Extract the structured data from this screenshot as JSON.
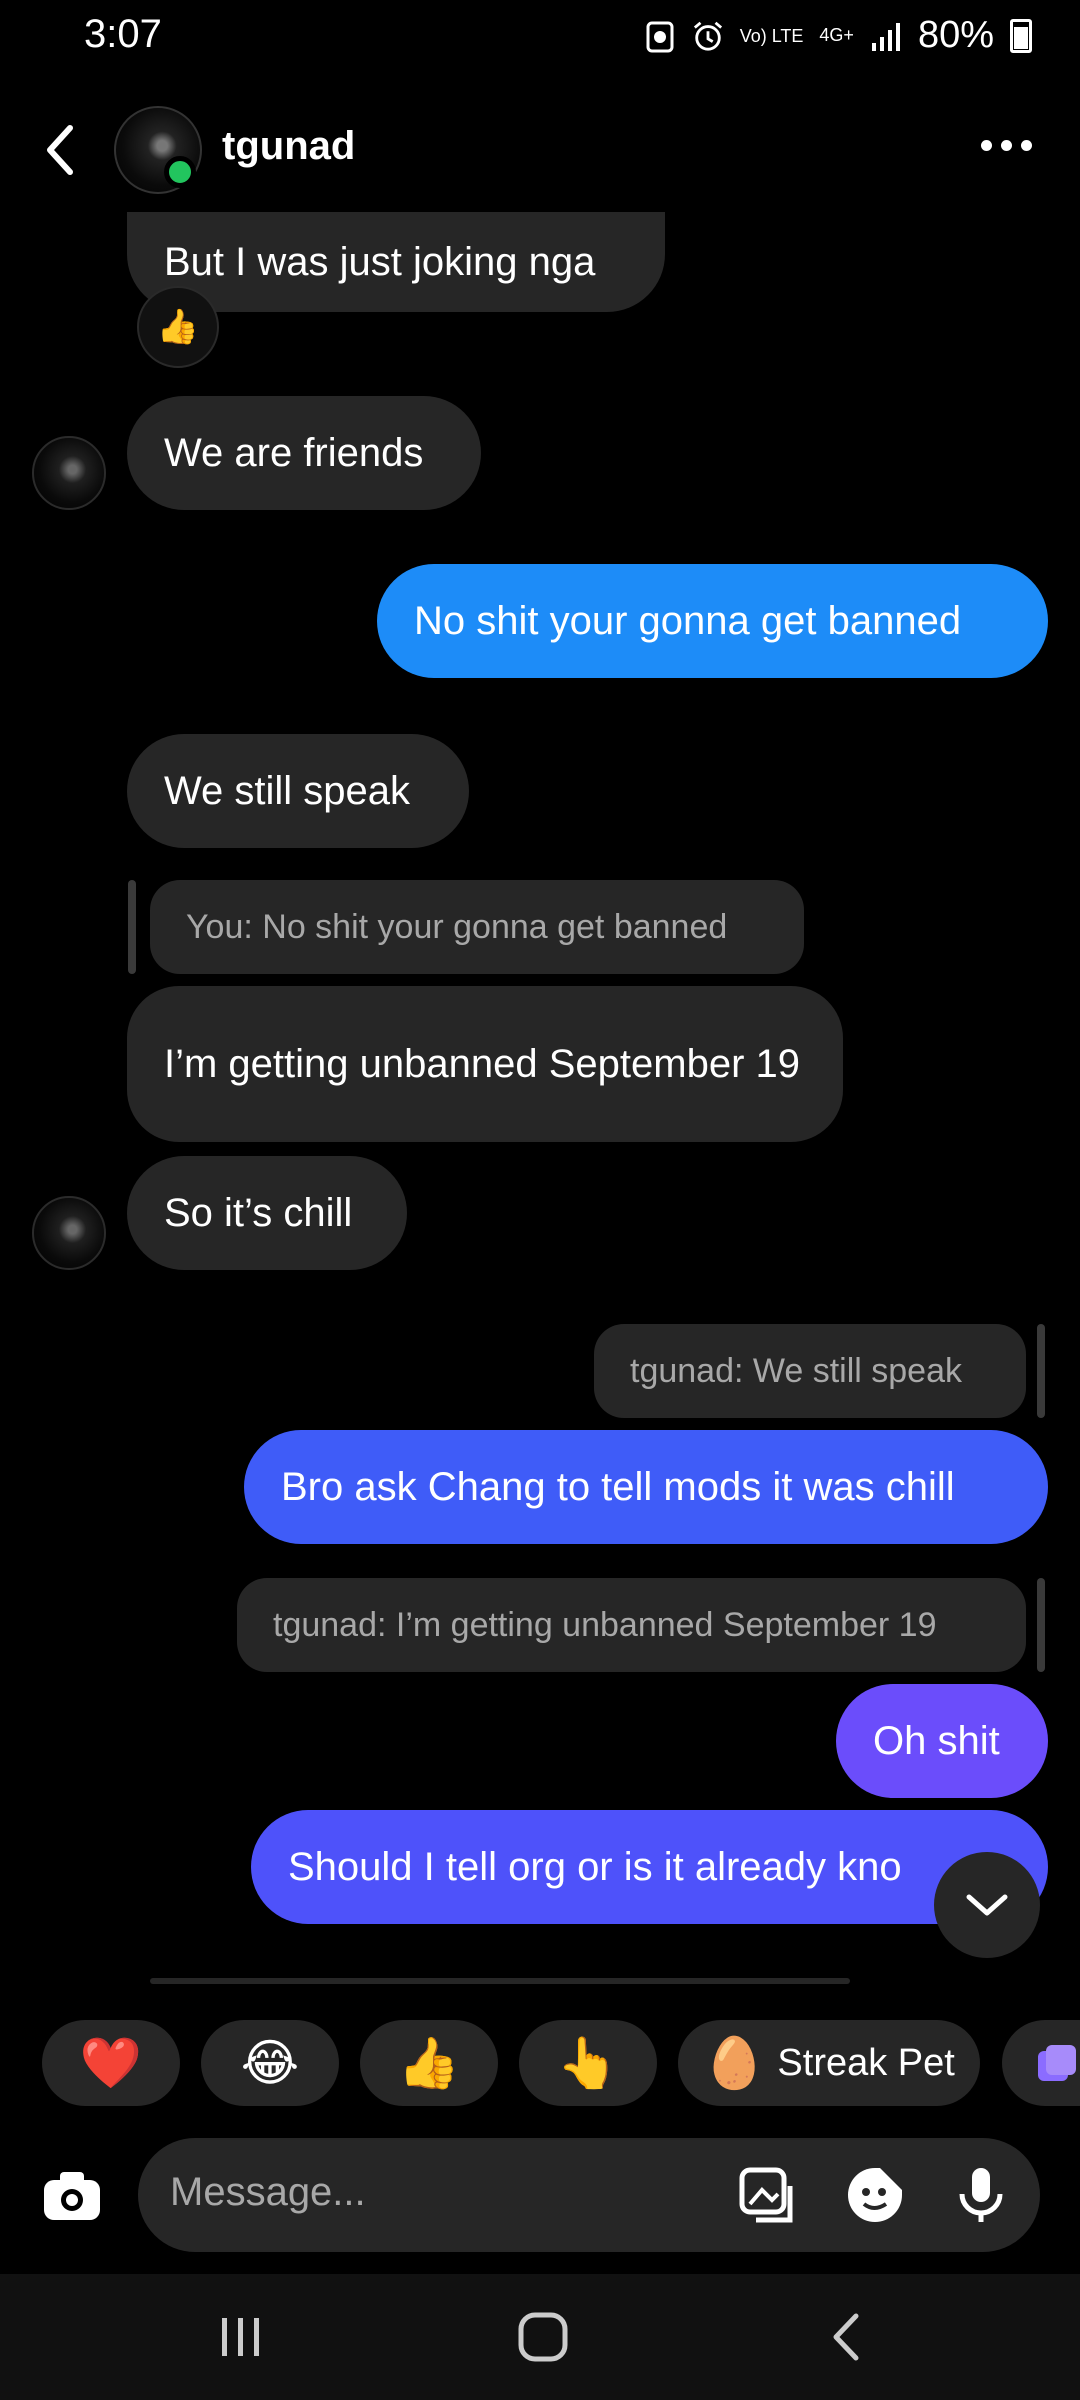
{
  "status_bar": {
    "time": "3:07",
    "network": "Vo) LTE",
    "network_gen": "4G+",
    "battery": "80%"
  },
  "header": {
    "username": "tgunad"
  },
  "messages": [
    {
      "sender": "them",
      "text": "But I was just joking nga",
      "reaction": "👍"
    },
    {
      "sender": "them",
      "text": "We are friends"
    },
    {
      "sender": "me",
      "text": "No shit your gonna get banned"
    },
    {
      "sender": "them",
      "text": "We still speak"
    },
    {
      "sender": "them",
      "reply_to": "You: No shit your gonna get banned",
      "text": "I’m getting unbanned September 19"
    },
    {
      "sender": "them",
      "text": "So it’s chill"
    },
    {
      "sender": "me",
      "reply_to": "tgunad: We still speak",
      "text": "Bro ask Chang to tell mods it was chill"
    },
    {
      "sender": "me",
      "reply_to": "tgunad: I’m getting unbanned September 19",
      "text": "Oh shit"
    },
    {
      "sender": "me",
      "text": "Should I tell org or is it already kno"
    }
  ],
  "quick_reactions": [
    "❤️",
    "😂",
    "👍",
    "👆"
  ],
  "streak_pet": {
    "emoji": "🥚",
    "label": "Streak Pet"
  },
  "composer": {
    "placeholder": "Message..."
  },
  "colors": {
    "bubble_them": "#262626",
    "bubble_me_blue": "#1d8cf8",
    "bubble_me_indigo": "#3d5afe",
    "bubble_me_purple": "#6b4dfb",
    "online": "#22c55e"
  }
}
